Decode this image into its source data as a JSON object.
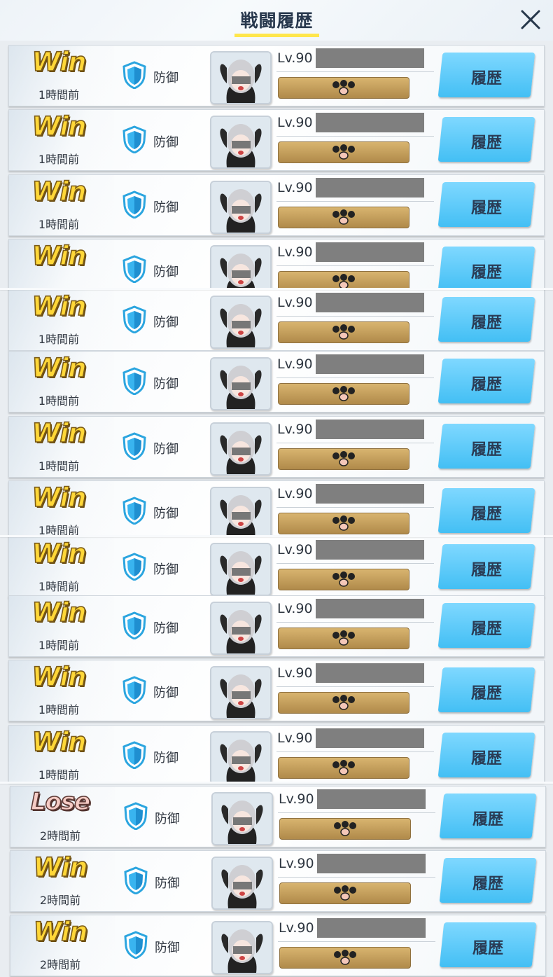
{
  "header": {
    "title": "戦闘履歴",
    "close_icon": "close-icon"
  },
  "colors": {
    "accent_underline": "#ffe64c",
    "history_button": "#4cc3f6",
    "win_text": "#ffd738",
    "lose_text": "#f6ccc5"
  },
  "rows": [
    {
      "result": "Win",
      "time": "1時間前",
      "type": "防御",
      "level": "Lv.90",
      "history": "履歴"
    },
    {
      "result": "Win",
      "time": "1時間前",
      "type": "防御",
      "level": "Lv.90",
      "history": "履歴"
    },
    {
      "result": "Win",
      "time": "1時間前",
      "type": "防御",
      "level": "Lv.90",
      "history": "履歴"
    },
    {
      "result": "Win",
      "time": "",
      "type": "防御",
      "level": "Lv.90",
      "history": "履歴"
    },
    {
      "result": "Win",
      "time": "1時間前",
      "type": "防御",
      "level": "Lv.90",
      "history": "履歴"
    },
    {
      "result": "Win",
      "time": "1時間前",
      "type": "防御",
      "level": "Lv.90",
      "history": "履歴"
    },
    {
      "result": "Win",
      "time": "1時間前",
      "type": "防御",
      "level": "Lv.90",
      "history": "履歴"
    },
    {
      "result": "Win",
      "time": "1時間前",
      "type": "防御",
      "level": "Lv.90",
      "history": "履歴"
    },
    {
      "result": "Win",
      "time": "1時間前",
      "type": "防御",
      "level": "Lv.90",
      "history": "履歴"
    },
    {
      "result": "Win",
      "time": "1時間前",
      "type": "防御",
      "level": "Lv.90",
      "history": "履歴"
    },
    {
      "result": "Win",
      "time": "1時間前",
      "type": "防御",
      "level": "Lv.90",
      "history": "履歴"
    },
    {
      "result": "Win",
      "time": "1時間前",
      "type": "防御",
      "level": "Lv.90",
      "history": "履歴"
    },
    {
      "result": "Lose",
      "time": "2時間前",
      "type": "防御",
      "level": "Lv.90",
      "history": "履歴"
    },
    {
      "result": "Win",
      "time": "2時間前",
      "type": "防御",
      "level": "Lv.90",
      "history": "履歴"
    },
    {
      "result": "Win",
      "time": "2時間前",
      "type": "防御",
      "level": "Lv.90",
      "history": "履歴"
    }
  ]
}
